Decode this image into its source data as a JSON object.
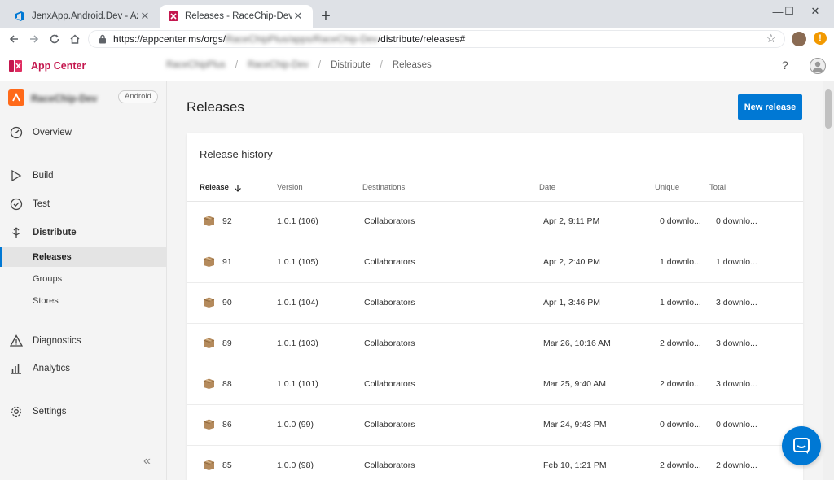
{
  "browser": {
    "tabs": [
      {
        "title": "JenxApp.Android.Dev - Azure Dev",
        "close": "✕"
      },
      {
        "title": "Releases - RaceChip-Dev - App C",
        "close": "✕"
      }
    ],
    "new_tab": "+",
    "window_controls": {
      "minimize": "—",
      "maximize": "☐",
      "close": "✕"
    },
    "url": {
      "prefix": "https://appcenter.ms/orgs/",
      "blurred": "RaceChipPlus/apps/RaceChip-Dev",
      "suffix": "/distribute/releases#"
    },
    "alert_badge": "!"
  },
  "app": {
    "brand": "App Center",
    "breadcrumb": [
      "RaceChipPlus",
      "RaceChip-Dev",
      "Distribute",
      "Releases"
    ],
    "breadcrumb_sep": "/",
    "help": "?"
  },
  "sidebar": {
    "app_name": "RaceChip-Dev",
    "platform": "Android",
    "items": [
      {
        "label": "Overview"
      },
      {
        "label": "Build"
      },
      {
        "label": "Test"
      },
      {
        "label": "Distribute"
      },
      {
        "label": "Diagnostics"
      },
      {
        "label": "Analytics"
      },
      {
        "label": "Settings"
      }
    ],
    "distribute_sub": [
      "Releases",
      "Groups",
      "Stores"
    ],
    "collapse": "«"
  },
  "main": {
    "title": "Releases",
    "new_release": "New release",
    "card_title": "Release history",
    "columns": [
      "Release",
      "Version",
      "Destinations",
      "Date",
      "Unique",
      "Total"
    ],
    "rows": [
      {
        "release": "92",
        "version": "1.0.1 (106)",
        "destinations": "Collaborators",
        "date": "Apr 2, 9:11 PM",
        "unique": "0 downlo...",
        "total": "0 downlo..."
      },
      {
        "release": "91",
        "version": "1.0.1 (105)",
        "destinations": "Collaborators",
        "date": "Apr 2, 2:40 PM",
        "unique": "1 downlo...",
        "total": "1 downlo..."
      },
      {
        "release": "90",
        "version": "1.0.1 (104)",
        "destinations": "Collaborators",
        "date": "Apr 1, 3:46 PM",
        "unique": "1 downlo...",
        "total": "3 downlo..."
      },
      {
        "release": "89",
        "version": "1.0.1 (103)",
        "destinations": "Collaborators",
        "date": "Mar 26, 10:16 AM",
        "unique": "2 downlo...",
        "total": "3 downlo..."
      },
      {
        "release": "88",
        "version": "1.0.1 (101)",
        "destinations": "Collaborators",
        "date": "Mar 25, 9:40 AM",
        "unique": "2 downlo...",
        "total": "3 downlo..."
      },
      {
        "release": "86",
        "version": "1.0.0 (99)",
        "destinations": "Collaborators",
        "date": "Mar 24, 9:43 PM",
        "unique": "0 downlo...",
        "total": "0 downlo..."
      },
      {
        "release": "85",
        "version": "1.0.0 (98)",
        "destinations": "Collaborators",
        "date": "Feb 10, 1:21 PM",
        "unique": "2 downlo...",
        "total": "2 downlo..."
      }
    ]
  },
  "colors": {
    "accent": "#0078d4",
    "brand": "#c4174e",
    "app_icon": "#ff6a1a"
  }
}
